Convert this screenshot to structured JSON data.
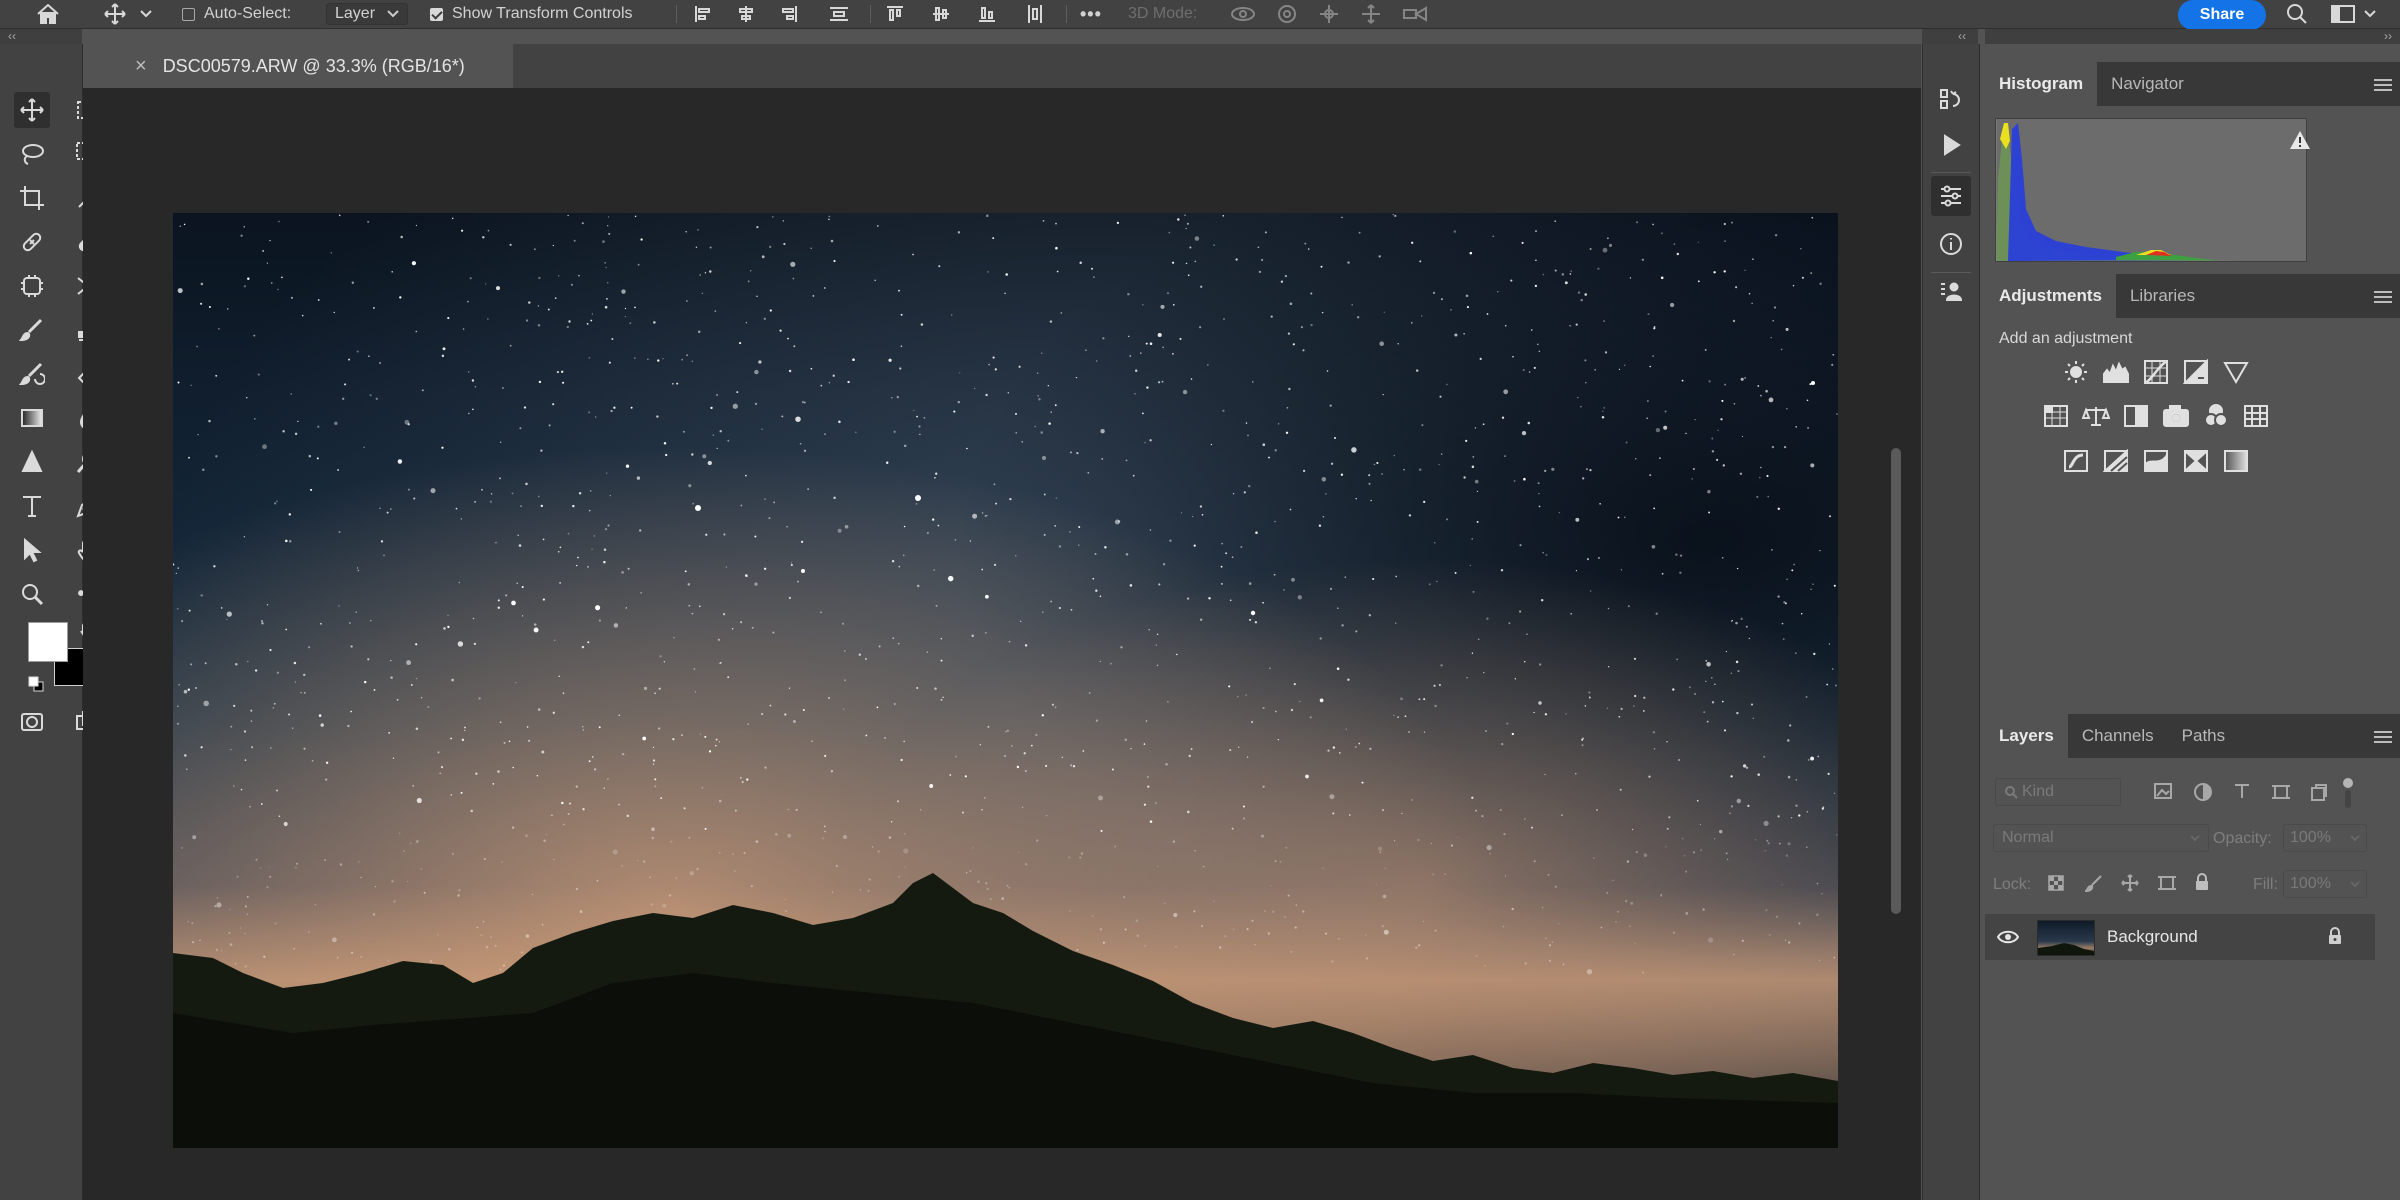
{
  "optionsBar": {
    "home_icon": "home-icon",
    "move_icon": "move-tool-icon",
    "auto_select_label": "Auto-Select:",
    "auto_select_checked": false,
    "auto_select_target": "Layer",
    "show_transform_label": "Show Transform Controls",
    "show_transform_checked": true,
    "more_label": "•••",
    "mode3d_label": "3D Mode:",
    "share_label": "Share"
  },
  "document": {
    "tab_title": "DSC00579.ARW @ 33.3% (RGB/16*)",
    "close_glyph": "×"
  },
  "strips": {
    "left_collapse": "‹‹",
    "right_expand": "‹‹",
    "panel_collapse": "››"
  },
  "histogram": {
    "tabs": [
      "Histogram",
      "Navigator"
    ],
    "active_tab": "Histogram",
    "warning_icon": "warning-icon"
  },
  "adjustments": {
    "tabs": [
      "Adjustments",
      "Libraries"
    ],
    "active_tab": "Adjustments",
    "prompt": "Add an adjustment",
    "icons_row1": [
      "brightness-contrast-icon",
      "levels-icon",
      "curves-icon",
      "exposure-icon",
      "vibrance-icon"
    ],
    "icons_row2": [
      "hue-saturation-icon",
      "color-balance-icon",
      "black-white-icon",
      "photo-filter-icon",
      "channel-mixer-icon",
      "color-lookup-icon"
    ],
    "icons_row3": [
      "invert-icon",
      "posterize-icon",
      "threshold-icon",
      "selective-color-icon",
      "gradient-map-icon"
    ]
  },
  "layers": {
    "tabs": [
      "Layers",
      "Channels",
      "Paths"
    ],
    "active_tab": "Layers",
    "filter_placeholder": "Kind",
    "blend_mode": "Normal",
    "opacity_label": "Opacity:",
    "opacity_value": "100%",
    "lock_label": "Lock:",
    "fill_label": "Fill:",
    "fill_value": "100%",
    "items": [
      {
        "name": "Background",
        "visible": true,
        "locked": true
      }
    ]
  },
  "colors": {
    "foreground": "#ffffff",
    "background": "#000000",
    "accent": "#1473e6"
  }
}
